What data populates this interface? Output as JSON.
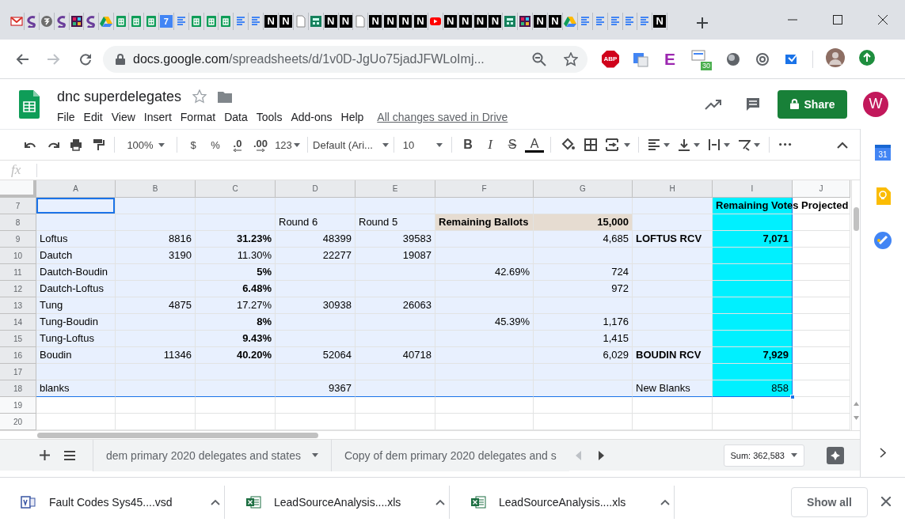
{
  "browser_tabs": [
    {
      "kind": "mail"
    },
    {
      "kind": "swirl"
    },
    {
      "kind": "grey"
    },
    {
      "kind": "swirl"
    },
    {
      "kind": "slack"
    },
    {
      "kind": "swirl"
    },
    {
      "kind": "drive"
    },
    {
      "kind": "sheets"
    },
    {
      "kind": "sheets"
    },
    {
      "kind": "sheets"
    },
    {
      "kind": "calendar",
      "glyph": "7"
    },
    {
      "kind": "docs"
    },
    {
      "kind": "sheets"
    },
    {
      "kind": "sheets"
    },
    {
      "kind": "sheets"
    },
    {
      "kind": "docs"
    },
    {
      "kind": "docs"
    },
    {
      "kind": "letter",
      "glyph": "N"
    },
    {
      "kind": "letter",
      "glyph": "N"
    },
    {
      "kind": "file"
    },
    {
      "kind": "teal"
    },
    {
      "kind": "letter",
      "glyph": "N"
    },
    {
      "kind": "letter",
      "glyph": "N"
    },
    {
      "kind": "file"
    },
    {
      "kind": "letter",
      "glyph": "N"
    },
    {
      "kind": "letter",
      "glyph": "N"
    },
    {
      "kind": "letter",
      "glyph": "N"
    },
    {
      "kind": "letter",
      "glyph": "N"
    },
    {
      "kind": "youtube"
    },
    {
      "kind": "letter",
      "glyph": "N"
    },
    {
      "kind": "letter",
      "glyph": "N"
    },
    {
      "kind": "letter",
      "glyph": "N"
    },
    {
      "kind": "letter",
      "glyph": "N"
    },
    {
      "kind": "teal"
    },
    {
      "kind": "slack"
    },
    {
      "kind": "letter",
      "glyph": "N"
    },
    {
      "kind": "letter",
      "glyph": "N"
    },
    {
      "kind": "drive"
    },
    {
      "kind": "docs"
    },
    {
      "kind": "docs"
    },
    {
      "kind": "docs"
    },
    {
      "kind": "docs"
    },
    {
      "kind": "docs"
    },
    {
      "kind": "letter",
      "glyph": "N"
    }
  ],
  "address_bar": {
    "host": "docs.google.com",
    "path": "/spreadsheets/d/1v0D-JgUo75jadJFWLoImj..."
  },
  "extensions": [
    {
      "kind": "abp",
      "label": "ABP"
    },
    {
      "kind": "translate"
    },
    {
      "kind": "letter",
      "label": "E"
    },
    {
      "kind": "badge",
      "badge": "30"
    },
    {
      "kind": "orb"
    },
    {
      "kind": "at"
    },
    {
      "kind": "scan"
    }
  ],
  "document": {
    "title": "dnc superdelegates",
    "menus": [
      "File",
      "Edit",
      "View",
      "Insert",
      "Format",
      "Data",
      "Tools",
      "Add-ons",
      "Help"
    ],
    "save_status": "All changes saved in Drive",
    "share": "Share",
    "avatar": "W"
  },
  "toolbar": {
    "zoom": "100%",
    "currency": "$",
    "percent": "%",
    "decrease_decimals": ".0",
    "increase_decimals": ".00",
    "more_formats": "123",
    "font": "Default (Ari...",
    "font_size": "10",
    "bold": "B",
    "italic": "I",
    "strikethrough": "S",
    "text_color": "A"
  },
  "formula_bar": {
    "label": "fx"
  },
  "grid": {
    "columns": [
      {
        "label": "A",
        "selected": true
      },
      {
        "label": "B",
        "selected": true
      },
      {
        "label": "C",
        "selected": true
      },
      {
        "label": "D",
        "selected": true
      },
      {
        "label": "E",
        "selected": true
      },
      {
        "label": "F",
        "selected": true
      },
      {
        "label": "G",
        "selected": true
      },
      {
        "label": "H",
        "selected": true
      },
      {
        "label": "I",
        "selected": true
      },
      {
        "label": "J",
        "selected": false
      }
    ],
    "rows": [
      {
        "number": "7",
        "selected": true,
        "cells": [
          {
            "active": true
          },
          {},
          {},
          {},
          {},
          {},
          {},
          {},
          {
            "text": "Remaining Votes Projected",
            "bold": true,
            "color": "#00f0ff"
          },
          {}
        ]
      },
      {
        "number": "8",
        "selected": true,
        "cells": [
          {},
          {},
          {},
          {
            "text": "Round 6"
          },
          {
            "text": "Round 5"
          },
          {
            "text": "Remaining Ballots",
            "bold": true,
            "color": "#e6dcd1"
          },
          {
            "text": "15,000",
            "kind": "number",
            "bold": true,
            "color": "#e6dcd1"
          },
          {},
          {
            "color": "#00f0ff"
          },
          {}
        ]
      },
      {
        "number": "9",
        "selected": true,
        "cells": [
          {
            "text": "Loftus"
          },
          {
            "text": "8816",
            "kind": "number"
          },
          {
            "text": "31.23%",
            "kind": "number",
            "bold": true
          },
          {
            "text": "48399",
            "kind": "number"
          },
          {
            "text": "39583",
            "kind": "number"
          },
          {},
          {
            "text": "4,685",
            "kind": "number"
          },
          {
            "text": "LOFTUS RCV",
            "bold": true
          },
          {
            "text": "7,071",
            "kind": "number",
            "bold": true,
            "color": "#00f0ff"
          },
          {}
        ]
      },
      {
        "number": "10",
        "selected": true,
        "cells": [
          {
            "text": "Dautch"
          },
          {
            "text": "3190",
            "kind": "number"
          },
          {
            "text": "11.30%",
            "kind": "number"
          },
          {
            "text": "22277",
            "kind": "number"
          },
          {
            "text": "19087",
            "kind": "number"
          },
          {},
          {},
          {},
          {
            "color": "#00f0ff"
          },
          {}
        ]
      },
      {
        "number": "11",
        "selected": true,
        "cells": [
          {
            "text": "Dautch-Boudin"
          },
          {},
          {
            "text": "5%",
            "kind": "number",
            "bold": true
          },
          {},
          {},
          {
            "text": "42.69%",
            "kind": "number"
          },
          {
            "text": "724",
            "kind": "number"
          },
          {},
          {
            "color": "#00f0ff"
          },
          {}
        ]
      },
      {
        "number": "12",
        "selected": true,
        "cells": [
          {
            "text": "Dautch-Loftus"
          },
          {},
          {
            "text": "6.48%",
            "kind": "number",
            "bold": true
          },
          {},
          {},
          {},
          {
            "text": "972",
            "kind": "number"
          },
          {},
          {
            "color": "#00f0ff"
          },
          {}
        ]
      },
      {
        "number": "13",
        "selected": true,
        "cells": [
          {
            "text": "Tung"
          },
          {
            "text": "4875",
            "kind": "number"
          },
          {
            "text": "17.27%",
            "kind": "number"
          },
          {
            "text": "30938",
            "kind": "number"
          },
          {
            "text": "26063",
            "kind": "number"
          },
          {},
          {},
          {},
          {
            "color": "#00f0ff"
          },
          {}
        ]
      },
      {
        "number": "14",
        "selected": true,
        "cells": [
          {
            "text": "Tung-Boudin"
          },
          {},
          {
            "text": "8%",
            "kind": "number",
            "bold": true
          },
          {},
          {},
          {
            "text": "45.39%",
            "kind": "number"
          },
          {
            "text": "1,176",
            "kind": "number"
          },
          {},
          {
            "color": "#00f0ff"
          },
          {}
        ]
      },
      {
        "number": "15",
        "selected": true,
        "cells": [
          {
            "text": "Tung-Loftus"
          },
          {},
          {
            "text": "9.43%",
            "kind": "number",
            "bold": true
          },
          {},
          {},
          {},
          {
            "text": "1,415",
            "kind": "number"
          },
          {},
          {
            "color": "#00f0ff"
          },
          {}
        ]
      },
      {
        "number": "16",
        "selected": true,
        "cells": [
          {
            "text": "Boudin"
          },
          {
            "text": "11346",
            "kind": "number"
          },
          {
            "text": "40.20%",
            "kind": "number",
            "bold": true
          },
          {
            "text": "52064",
            "kind": "number"
          },
          {
            "text": "40718",
            "kind": "number"
          },
          {},
          {
            "text": "6,029",
            "kind": "number"
          },
          {
            "text": "BOUDIN RCV",
            "bold": true
          },
          {
            "text": "7,929",
            "kind": "number",
            "bold": true,
            "color": "#00f0ff"
          },
          {}
        ]
      },
      {
        "number": "17",
        "selected": true,
        "cells": [
          {},
          {},
          {},
          {},
          {},
          {},
          {},
          {},
          {
            "color": "#00f0ff"
          },
          {}
        ]
      },
      {
        "number": "18",
        "selected": true,
        "cells": [
          {
            "text": "blanks"
          },
          {},
          {},
          {
            "text": "9367",
            "kind": "number"
          },
          {},
          {},
          {},
          {
            "text": "New Blanks"
          },
          {
            "text": "858",
            "kind": "number",
            "color": "#00f0ff"
          },
          {}
        ]
      },
      {
        "number": "19",
        "selected": false,
        "cells": [
          {},
          {},
          {},
          {},
          {},
          {},
          {},
          {},
          {},
          {}
        ]
      },
      {
        "number": "20",
        "selected": false,
        "cells": [
          {},
          {},
          {},
          {},
          {},
          {},
          {},
          {},
          {},
          {}
        ]
      }
    ]
  },
  "sheet_tabs": [
    {
      "label": "dem primary 2020 delegates and states",
      "selected": false
    },
    {
      "label": "Copy of dem primary 2020 delegates and s",
      "selected": false
    }
  ],
  "sum": "Sum: 362,583",
  "side_panel": {
    "calendar_day": "31"
  },
  "downloads": [
    {
      "kind": "visio",
      "name": "Fault Codes Sys45....vsd"
    },
    {
      "kind": "excel",
      "name": "LeadSourceAnalysis....xls"
    },
    {
      "kind": "excel",
      "name": "LeadSourceAnalysis....xls"
    }
  ],
  "show_all": "Show all"
}
